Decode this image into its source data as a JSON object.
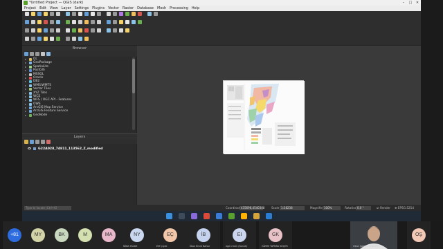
{
  "window": {
    "title": "*Untitled Project — QGIS (dark)"
  },
  "menu": [
    "Project",
    "Edit",
    "View",
    "Layer",
    "Settings",
    "Plugins",
    "Vector",
    "Raster",
    "Database",
    "Mesh",
    "Processing",
    "Help"
  ],
  "browser": {
    "title": "Browser",
    "items": [
      {
        "label": "DL",
        "icon_color": "#e0c060"
      },
      {
        "label": "GeoPackage",
        "icon_color": "#7fb2e5"
      },
      {
        "label": "SpatiaLite",
        "icon_color": "#9bd48a"
      },
      {
        "label": "PostGIS",
        "icon_color": "#5b8fd6"
      },
      {
        "label": "MSSQL",
        "icon_color": "#c8c8c8"
      },
      {
        "label": "Oracle",
        "icon_color": "#d9534f"
      },
      {
        "label": "DB2",
        "icon_color": "#5bc0de"
      },
      {
        "label": "WMS/WMTS",
        "icon_color": "#8ac3e6"
      },
      {
        "label": "Vector Tiles",
        "icon_color": "#a4c878"
      },
      {
        "label": "XYZ Tiles",
        "icon_color": "#8ac3e6"
      },
      {
        "label": "WCS",
        "icon_color": "#8ac3e6"
      },
      {
        "label": "WFS / OGC API - Features",
        "icon_color": "#8ac3e6"
      },
      {
        "label": "OWS",
        "icon_color": "#8ac3e6"
      },
      {
        "label": "ArcGIS Map Service",
        "icon_color": "#6fa8dc"
      },
      {
        "label": "ArcGIS Feature Service",
        "icon_color": "#6fa8dc"
      },
      {
        "label": "GeoNode",
        "icon_color": "#6fb356"
      }
    ]
  },
  "layers": {
    "title": "Layers",
    "items": [
      {
        "label": "G22A028_74811_113562_Z_modified"
      }
    ]
  },
  "statusbar": {
    "locator_placeholder": "Type to locate (Ctrl+K)",
    "coordinate_label": "Coordinate",
    "coordinate_value": "435698,4540348",
    "scale_label": "Scale",
    "scale_value": "1:38238",
    "magnifier_label": "Magnifier",
    "magnifier_value": "100%",
    "rotation_label": "Rotation",
    "rotation_value": "0.0 °",
    "render_label": "Render",
    "crs_label": "EPSG:5254"
  },
  "participants": [
    {
      "initials": "+81",
      "name": "",
      "color": "#2d6cdf"
    },
    {
      "initials": "MY",
      "name": "",
      "color": "#d3d3a8"
    },
    {
      "initials": "BK",
      "name": "",
      "color": "#c8d9c0"
    },
    {
      "initials": "M",
      "name": "",
      "color": "#d4e0b0"
    },
    {
      "initials": "MA",
      "name": "",
      "color": "#e8b7c9"
    },
    {
      "initials": "NY",
      "name": "NİDA YILDIZ",
      "color": "#c9d7ef"
    },
    {
      "initials": "EÇ",
      "name": "Elif Çiçek",
      "color": "#f2c6a8"
    },
    {
      "initials": "İB",
      "name": "İlkan Emre Bahar",
      "color": "#c6d3ee"
    },
    {
      "initials": "EI",
      "name": "ege ırmen (Konuk)",
      "color": "#cbd6ee"
    },
    {
      "initials": "GK",
      "name": "GİZEM YAPRAK KOÇER",
      "color": "#e8c2c6"
    },
    {
      "initials": "",
      "name": "Okan Şahin - ArkeoEO",
      "color": "#2f3236"
    },
    {
      "initials": "OŞ",
      "name": "",
      "color": "#f3c9b5"
    }
  ]
}
